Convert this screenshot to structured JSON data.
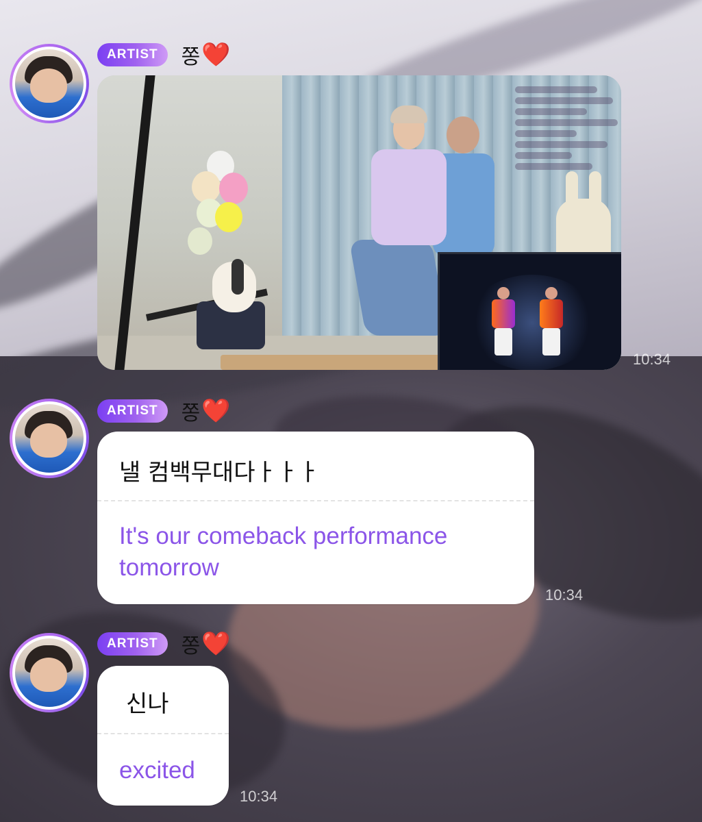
{
  "colors": {
    "badge_gradient_start": "#7b3ff2",
    "badge_gradient_end": "#cf9af6",
    "translation_text": "#8b55e8",
    "heart": "#e4142b",
    "bubble_bg": "#ffffff"
  },
  "messages": [
    {
      "badge": "ARTIST",
      "sender": "쫑",
      "heart": "❤️",
      "type": "image",
      "time": "10:34"
    },
    {
      "badge": "ARTIST",
      "sender": "쫑",
      "heart": "❤️",
      "type": "text",
      "original": "낼 컴백무대다ㅏㅏㅏ",
      "translation_line1": "It's our comeback performance",
      "translation_line2": "tomorrow",
      "time": "10:34"
    },
    {
      "badge": "ARTIST",
      "sender": "쫑",
      "heart": "❤️",
      "type": "text",
      "original": "신나",
      "translation_line1": "excited",
      "time": "10:34"
    }
  ]
}
